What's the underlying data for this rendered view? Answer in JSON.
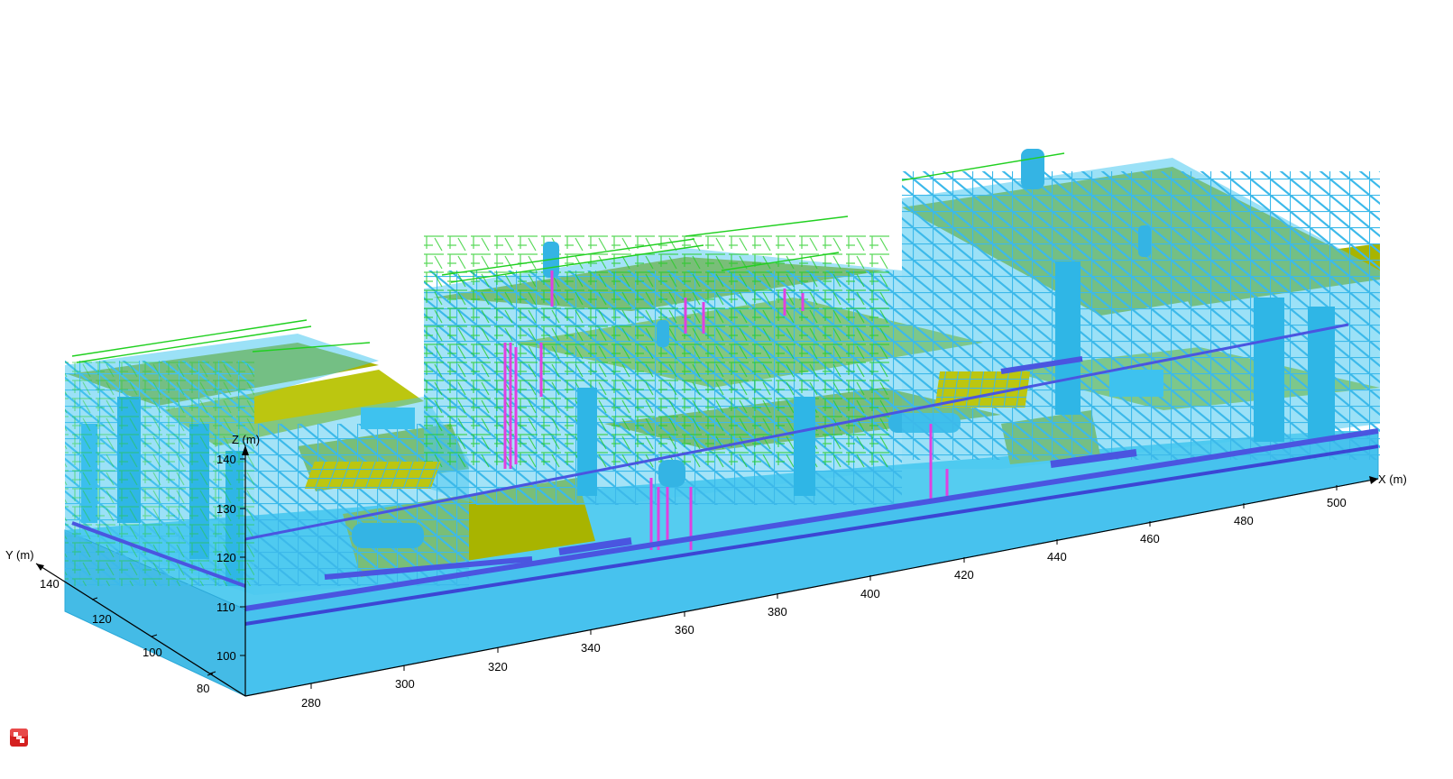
{
  "viewer": {
    "colors": {
      "background": "#ffffff",
      "base_top": "#55ccf0",
      "base_side": "#47c2ee",
      "base_edge": "#2ba8d8",
      "structure": "#49c8f0",
      "structure_dark": "#2b9fd0",
      "deck": "#a8b400",
      "deck_light": "#bcc610",
      "piping_green": "#20d020",
      "piping_blue": "#4a55e0",
      "piping_magenta": "#e040e0",
      "axis": "#000000"
    }
  },
  "axes": {
    "x": {
      "label": "X (m)",
      "ticks": [
        "280",
        "300",
        "320",
        "340",
        "360",
        "380",
        "400",
        "420",
        "440",
        "460",
        "480",
        "500"
      ]
    },
    "y": {
      "label": "Y (m)",
      "ticks": [
        "80",
        "100",
        "120",
        "140"
      ]
    },
    "z": {
      "label": "Z (m)",
      "ticks": [
        "100",
        "110",
        "120",
        "130",
        "140"
      ]
    }
  },
  "icons": {
    "logo": "app-logo-icon"
  }
}
